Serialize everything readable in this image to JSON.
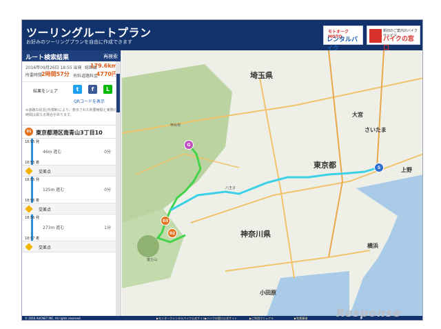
{
  "header": {
    "title": "ツーリングルートプラン",
    "subtitle": "お好みのツーリングプランを自由に作成できます",
    "logo_rental_top": "モトオークMOTO",
    "logo_rental_main": "レンタルバイク",
    "logo_bike_top": "新旧のご案内のバイクサービス",
    "logo_bike_main": "バイクの窓口"
  },
  "sidebar": {
    "heading": "ルート検索結果",
    "research": "再検索",
    "date": "2016年09月26日 18:55 出発",
    "total_distance_label": "総距離",
    "total_distance": "179.6km",
    "required_time_label": "所要時間",
    "required_time": "2時間57分",
    "toll_label": "有料道路料金",
    "toll": "4770円",
    "share_label": "結果をシェア",
    "qr_label": "QRコードを表示",
    "note": "※道路の状況(渋滞等)により、表示された所要時間と実際の時間は異なる場合があります。",
    "start_address": "東京都港区南青山3丁目10",
    "start_pin": "01",
    "steps": [
      {
        "depart": "18:55 発",
        "distance": "46m 進む",
        "minutes": "0分",
        "arrive": "18:55 着"
      },
      {
        "depart": "18:55 発",
        "distance": "125m 進む",
        "minutes": "0分",
        "arrive": "18:56 着"
      },
      {
        "depart": "18:56 発",
        "distance": "273m 進む",
        "minutes": "1分",
        "arrive": "18:57 着"
      }
    ],
    "crossing_label": "交差点"
  },
  "map": {
    "labels": {
      "saitama": "埼玉県",
      "tokyo": "東京都",
      "kanagawa": "神奈川県",
      "yamanashi_city": "甲州市",
      "saitama_city": "さいたま",
      "omiya": "大宮",
      "yokohama": "横浜",
      "odawara": "小田原",
      "fujisan": "富士山",
      "hachioji": "八王子",
      "ueno": "上野"
    },
    "pins": {
      "goal": "G",
      "start": "S",
      "p02": "02",
      "p03": "03"
    }
  },
  "footer": {
    "copyright": "© 2016 AUCNET INC. All rights reserved.",
    "link1": "▶モトオークレンタルバイク公式サイト",
    "link2": "▶バイクの窓口公式サイト",
    "link3": "▶ご利用マニュアル",
    "link4": "▶免責事項"
  },
  "watermark": "Response",
  "colors": {
    "header": "#12326b",
    "accent": "#e05a17",
    "route": "#3ad0e8"
  }
}
